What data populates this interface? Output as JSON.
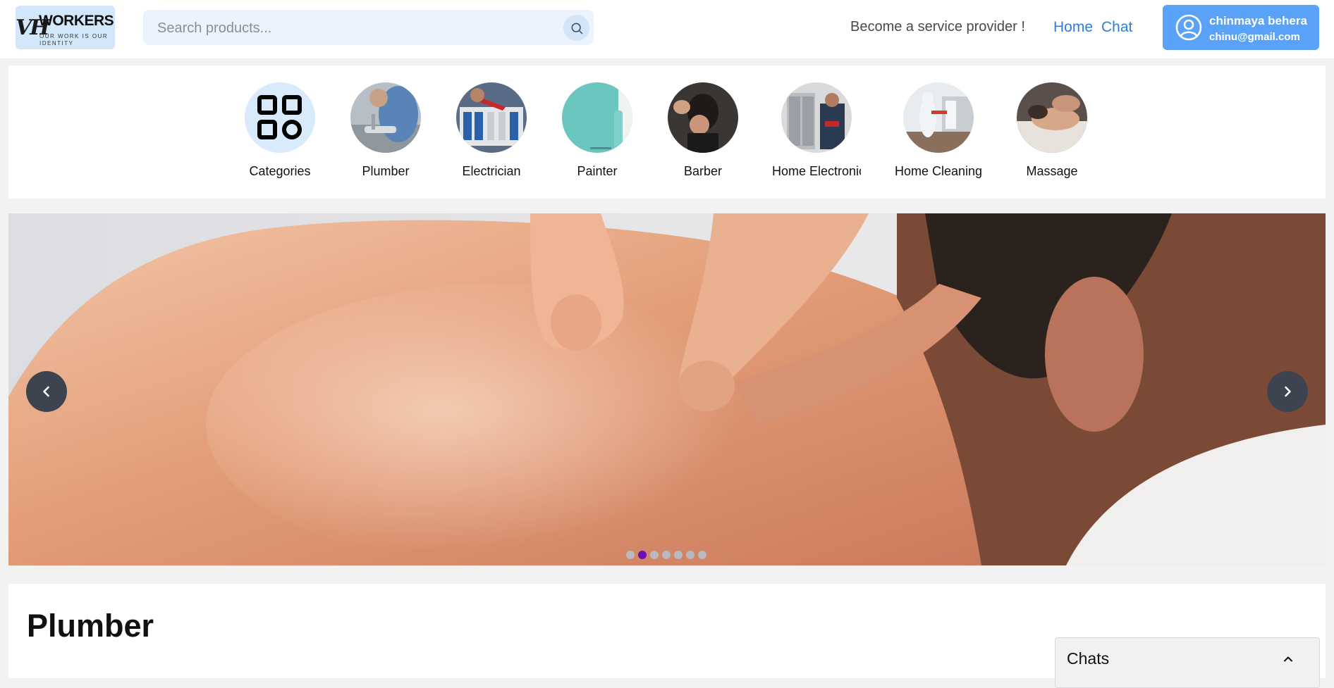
{
  "header": {
    "logo": {
      "mark": "VH",
      "name": "WORKERS HIVE",
      "tagline": "OUR WORK IS OUR IDENTITY"
    },
    "search": {
      "placeholder": "Search products..."
    },
    "provider_link": "Become a service provider !",
    "nav": {
      "home": "Home",
      "chat": "Chat"
    },
    "user": {
      "name": "chinmaya behera",
      "email": "chinu@gmail.com"
    }
  },
  "categories": [
    {
      "label": "Categories",
      "icon": "grid-icon"
    },
    {
      "label": "Plumber"
    },
    {
      "label": "Electrician"
    },
    {
      "label": "Painter"
    },
    {
      "label": "Barber"
    },
    {
      "label": "Home Electronics"
    },
    {
      "label": "Home Cleaning"
    },
    {
      "label": "Massage"
    }
  ],
  "carousel": {
    "slide_count": 7,
    "active_index": 1
  },
  "section": {
    "title": "Plumber"
  },
  "chats": {
    "title": "Chats"
  },
  "colors": {
    "accent_blue": "#5aa2f8",
    "link_blue": "#2f7ed8",
    "dot_active": "#6b10b8",
    "search_bg": "#ebf4fe"
  }
}
